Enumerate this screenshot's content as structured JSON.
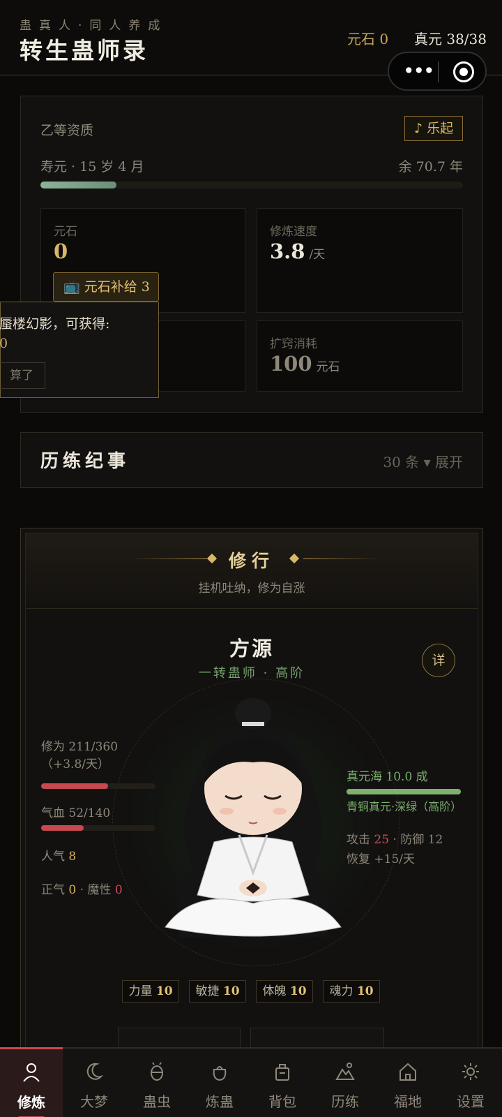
{
  "header": {
    "subtitle": "蛊真人·同人养成",
    "title": "转生蛊师录",
    "stones": "元石 0",
    "zhenyuan": "真元 38/38"
  },
  "overview": {
    "aptitude": "乙等资质",
    "music_button": "♪ 乐起",
    "lifespan": "寿元 · 15 岁 4 月",
    "lifespan_remaining": "余 70.7 年",
    "lifespan_progress": 0.18,
    "stone_label": "元石",
    "stone_value": "0",
    "speed_label": "修炼速度",
    "speed_value": "3.8",
    "speed_unit": "/天",
    "refill_button": "元石补给 3",
    "expand_label": "扩窍消耗",
    "expand_value": "100",
    "expand_unit": "元石"
  },
  "popup": {
    "line1": "蜃楼幻影，可获得:",
    "line2": "0",
    "cancel": "算了"
  },
  "journal": {
    "title": "历练纪事",
    "count": "30 条 ▾ 展开"
  },
  "cultivation": {
    "title": "修行",
    "subtitle": "挂机吐纳，修为自涨",
    "name": "方源",
    "rank": "一转蛊师 · 高阶",
    "detail_button": "详",
    "xiuwei": "修为 211/360（+3.8/天）",
    "xiuwei_progress": 0.586,
    "qixue": "气血 52/140",
    "qixue_progress": 0.371,
    "renqi_label": "人气",
    "renqi_value": "8",
    "zhengqi_label": "正气",
    "zhengqi_value": "0",
    "moxing_label": "· 魔性",
    "moxing_value": "0",
    "sea_label": "真元海",
    "sea_value": "10.0 成",
    "sea_progress": 1.0,
    "essence": "青铜真元·深绿（高阶）",
    "attack_label": "攻击",
    "attack_value": "25",
    "defense_label": "· 防御",
    "defense_value": "12",
    "recover": "恢复 +15/天",
    "attributes": [
      {
        "label": "力量",
        "value": "10"
      },
      {
        "label": "敏捷",
        "value": "10"
      },
      {
        "label": "体魄",
        "value": "10"
      },
      {
        "label": "魂力",
        "value": "10"
      }
    ]
  },
  "nav": [
    {
      "label": "修炼",
      "icon": "person-icon",
      "active": true
    },
    {
      "label": "大梦",
      "icon": "moon-icon"
    },
    {
      "label": "蛊虫",
      "icon": "bug-icon"
    },
    {
      "label": "炼蛊",
      "icon": "pot-icon"
    },
    {
      "label": "背包",
      "icon": "bag-icon"
    },
    {
      "label": "历练",
      "icon": "mountain-icon"
    },
    {
      "label": "福地",
      "icon": "home-icon"
    },
    {
      "label": "设置",
      "icon": "gear-icon"
    }
  ],
  "colors": {
    "accent": "#d9b766",
    "active": "#c8484f",
    "xiuwei_bar": "#c8484f",
    "sea_bar": "#7fb06e"
  }
}
